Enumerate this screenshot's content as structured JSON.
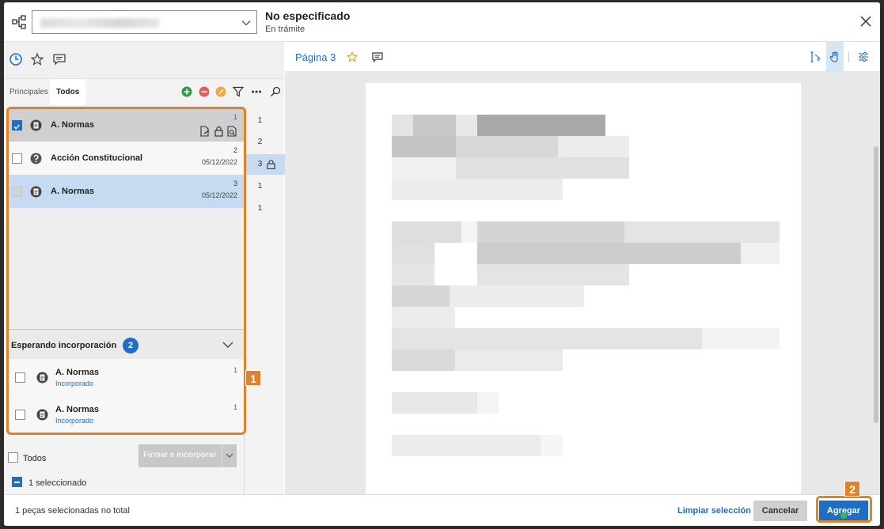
{
  "header": {
    "title": "No especificado",
    "subtitle": "En trámite",
    "select_value": ""
  },
  "left_tabs": [
    "history-icon",
    "star-icon",
    "comment-icon"
  ],
  "subtabs": {
    "principales": "Principales",
    "todos": "Todos"
  },
  "documents": [
    {
      "name": "A. Normas",
      "number": "1",
      "date": "",
      "checked": true
    },
    {
      "name": "Acción Constitucional",
      "number": "2",
      "date": "05/12/2022",
      "checked": false
    },
    {
      "name": "A. Normas",
      "number": "3",
      "date": "05/12/2022",
      "checked": false
    }
  ],
  "waiting": {
    "title": "Esperando incorporación",
    "count": "2",
    "items": [
      {
        "name": "A. Normas",
        "status": "Incorporado",
        "number": "1"
      },
      {
        "name": "A. Normas",
        "status": "Incorporado",
        "number": "1"
      }
    ]
  },
  "bottom": {
    "todos_label": "Todos",
    "firmar_label": "Firmar e incorporar",
    "selected_label": "1 seleccionado"
  },
  "pages": [
    {
      "num": "1",
      "locked": false
    },
    {
      "num": "2",
      "locked": false
    },
    {
      "num": "3",
      "locked": true
    },
    {
      "num": "1",
      "locked": false
    },
    {
      "num": "1",
      "locked": false
    }
  ],
  "viewer": {
    "page_label": "Página 3"
  },
  "footer": {
    "status_text": "1 peças selecionadas no total",
    "clear_label": "Limpiar selección",
    "cancel_label": "Cancelar",
    "add_label": "Agregar"
  },
  "annotations": {
    "marker1": "1",
    "marker2": "2"
  },
  "colors": {
    "accent": "#1e6fc3",
    "highlight": "#e0822a",
    "selected_row": "#c6dbf2"
  }
}
